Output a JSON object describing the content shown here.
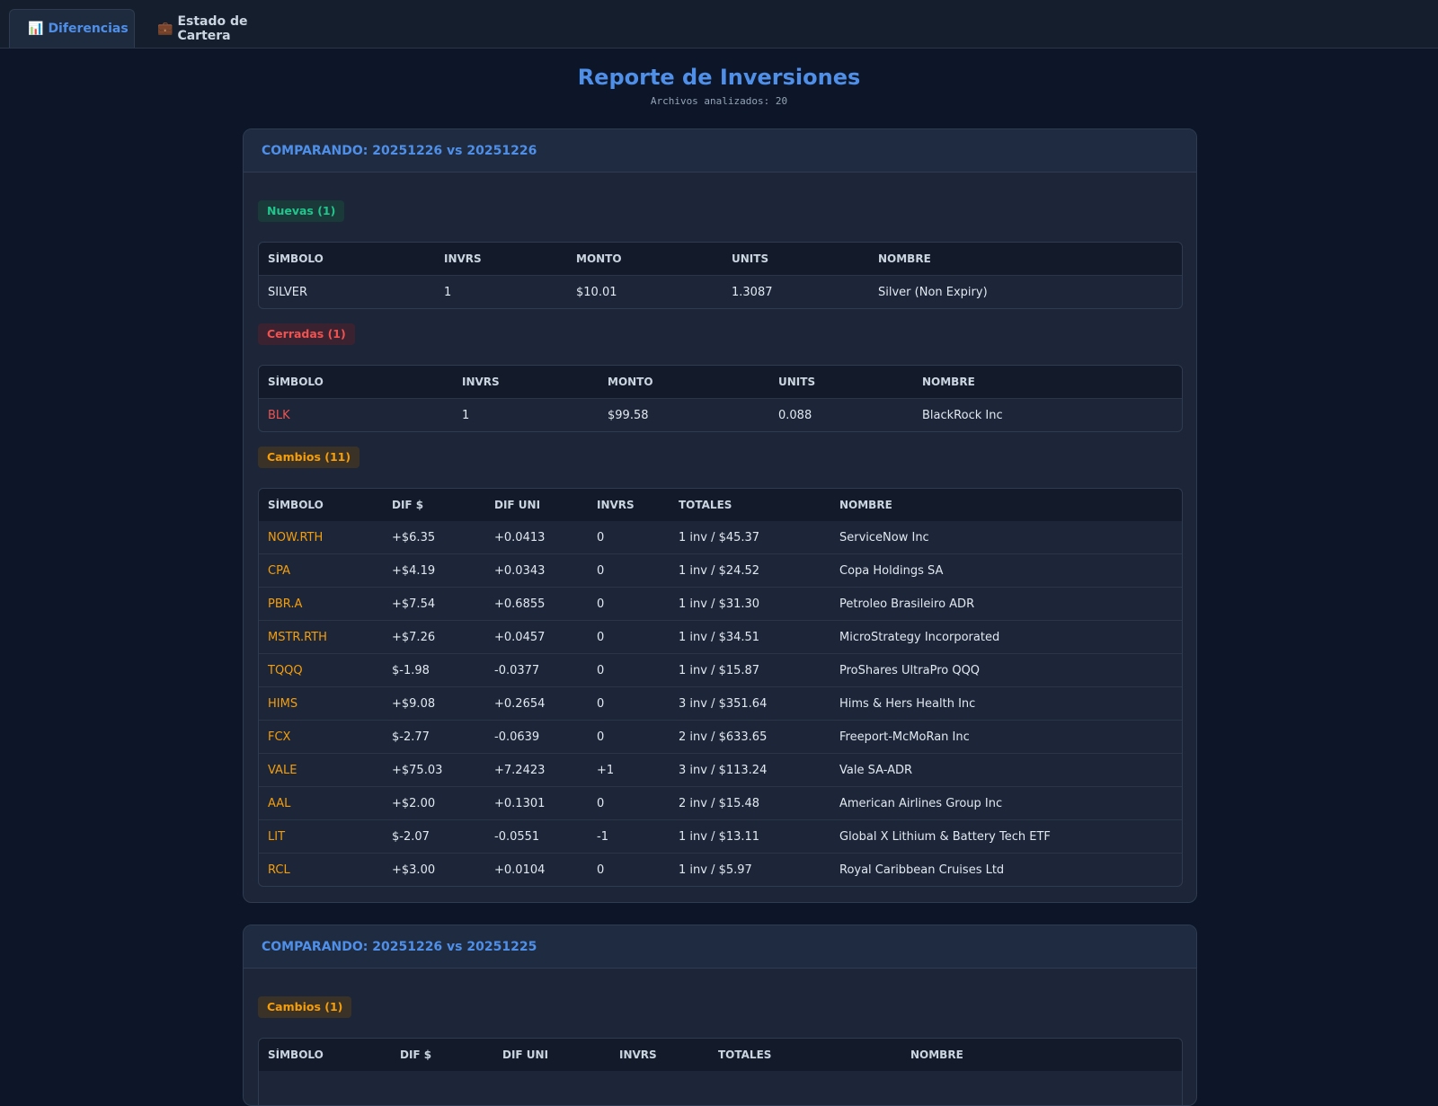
{
  "tabs": [
    {
      "label": "Diferencias",
      "icon": "📊",
      "icon_name": "bar-chart-icon",
      "active": true
    },
    {
      "label": "Estado de Cartera",
      "icon": "💼",
      "icon_name": "briefcase-icon",
      "active": false
    }
  ],
  "header": {
    "title": "Reporte de Inversiones",
    "subtitle": "Archivos analizados: 20"
  },
  "comparisons": [
    {
      "title": "COMPARANDO: 20251226 vs 20251226",
      "nuevas": {
        "label": "Nuevas (1)",
        "columns": [
          "SÍMBOLO",
          "INVRS",
          "MONTO",
          "UNITS",
          "NOMBRE"
        ],
        "rows": [
          {
            "simbolo": "SILVER",
            "invrs": "1",
            "monto": "$10.01",
            "units": "1.3087",
            "nombre": "Silver (Non Expiry)"
          }
        ]
      },
      "cerradas": {
        "label": "Cerradas (1)",
        "columns": [
          "SÍMBOLO",
          "INVRS",
          "MONTO",
          "UNITS",
          "NOMBRE"
        ],
        "rows": [
          {
            "simbolo": "BLK",
            "invrs": "1",
            "monto": "$99.58",
            "units": "0.088",
            "nombre": "BlackRock Inc"
          }
        ]
      },
      "cambios": {
        "label": "Cambios (11)",
        "columns": [
          "SÍMBOLO",
          "DIF $",
          "DIF UNI",
          "INVRS",
          "TOTALES",
          "NOMBRE"
        ],
        "rows": [
          {
            "simbolo": "NOW.RTH",
            "dif": "+$6.35",
            "difuni": "+0.0413",
            "invrs": "0",
            "totales": "1 inv / $45.37",
            "nombre": "ServiceNow Inc"
          },
          {
            "simbolo": "CPA",
            "dif": "+$4.19",
            "difuni": "+0.0343",
            "invrs": "0",
            "totales": "1 inv / $24.52",
            "nombre": "Copa Holdings SA"
          },
          {
            "simbolo": "PBR.A",
            "dif": "+$7.54",
            "difuni": "+0.6855",
            "invrs": "0",
            "totales": "1 inv / $31.30",
            "nombre": "Petroleo Brasileiro ADR"
          },
          {
            "simbolo": "MSTR.RTH",
            "dif": "+$7.26",
            "difuni": "+0.0457",
            "invrs": "0",
            "totales": "1 inv / $34.51",
            "nombre": "MicroStrategy Incorporated"
          },
          {
            "simbolo": "TQQQ",
            "dif": "$-1.98",
            "difuni": "-0.0377",
            "invrs": "0",
            "totales": "1 inv / $15.87",
            "nombre": "ProShares UltraPro QQQ"
          },
          {
            "simbolo": "HIMS",
            "dif": "+$9.08",
            "difuni": "+0.2654",
            "invrs": "0",
            "totales": "3 inv / $351.64",
            "nombre": "Hims & Hers Health Inc"
          },
          {
            "simbolo": "FCX",
            "dif": "$-2.77",
            "difuni": "-0.0639",
            "invrs": "0",
            "totales": "2 inv / $633.65",
            "nombre": "Freeport-McMoRan Inc"
          },
          {
            "simbolo": "VALE",
            "dif": "+$75.03",
            "difuni": "+7.2423",
            "invrs": "+1",
            "totales": "3 inv / $113.24",
            "nombre": "Vale SA-ADR"
          },
          {
            "simbolo": "AAL",
            "dif": "+$2.00",
            "difuni": "+0.1301",
            "invrs": "0",
            "totales": "2 inv / $15.48",
            "nombre": "American Airlines Group Inc"
          },
          {
            "simbolo": "LIT",
            "dif": "$-2.07",
            "difuni": "-0.0551",
            "invrs": "-1",
            "totales": "1 inv / $13.11",
            "nombre": "Global X Lithium & Battery Tech ETF"
          },
          {
            "simbolo": "RCL",
            "dif": "+$3.00",
            "difuni": "+0.0104",
            "invrs": "0",
            "totales": "1 inv / $5.97",
            "nombre": "Royal Caribbean Cruises Ltd"
          }
        ]
      }
    },
    {
      "title": "COMPARANDO: 20251226 vs 20251225",
      "cambios": {
        "label": "Cambios (1)",
        "columns": [
          "SÍMBOLO",
          "DIF $",
          "DIF UNI",
          "INVRS",
          "TOTALES",
          "NOMBRE"
        ]
      }
    }
  ],
  "colors": {
    "accent": "#4f8fe8",
    "nuevas": "#22c58b",
    "cerradas": "#ef5350",
    "cambios": "#f59e0b",
    "background": "#0d1628"
  }
}
